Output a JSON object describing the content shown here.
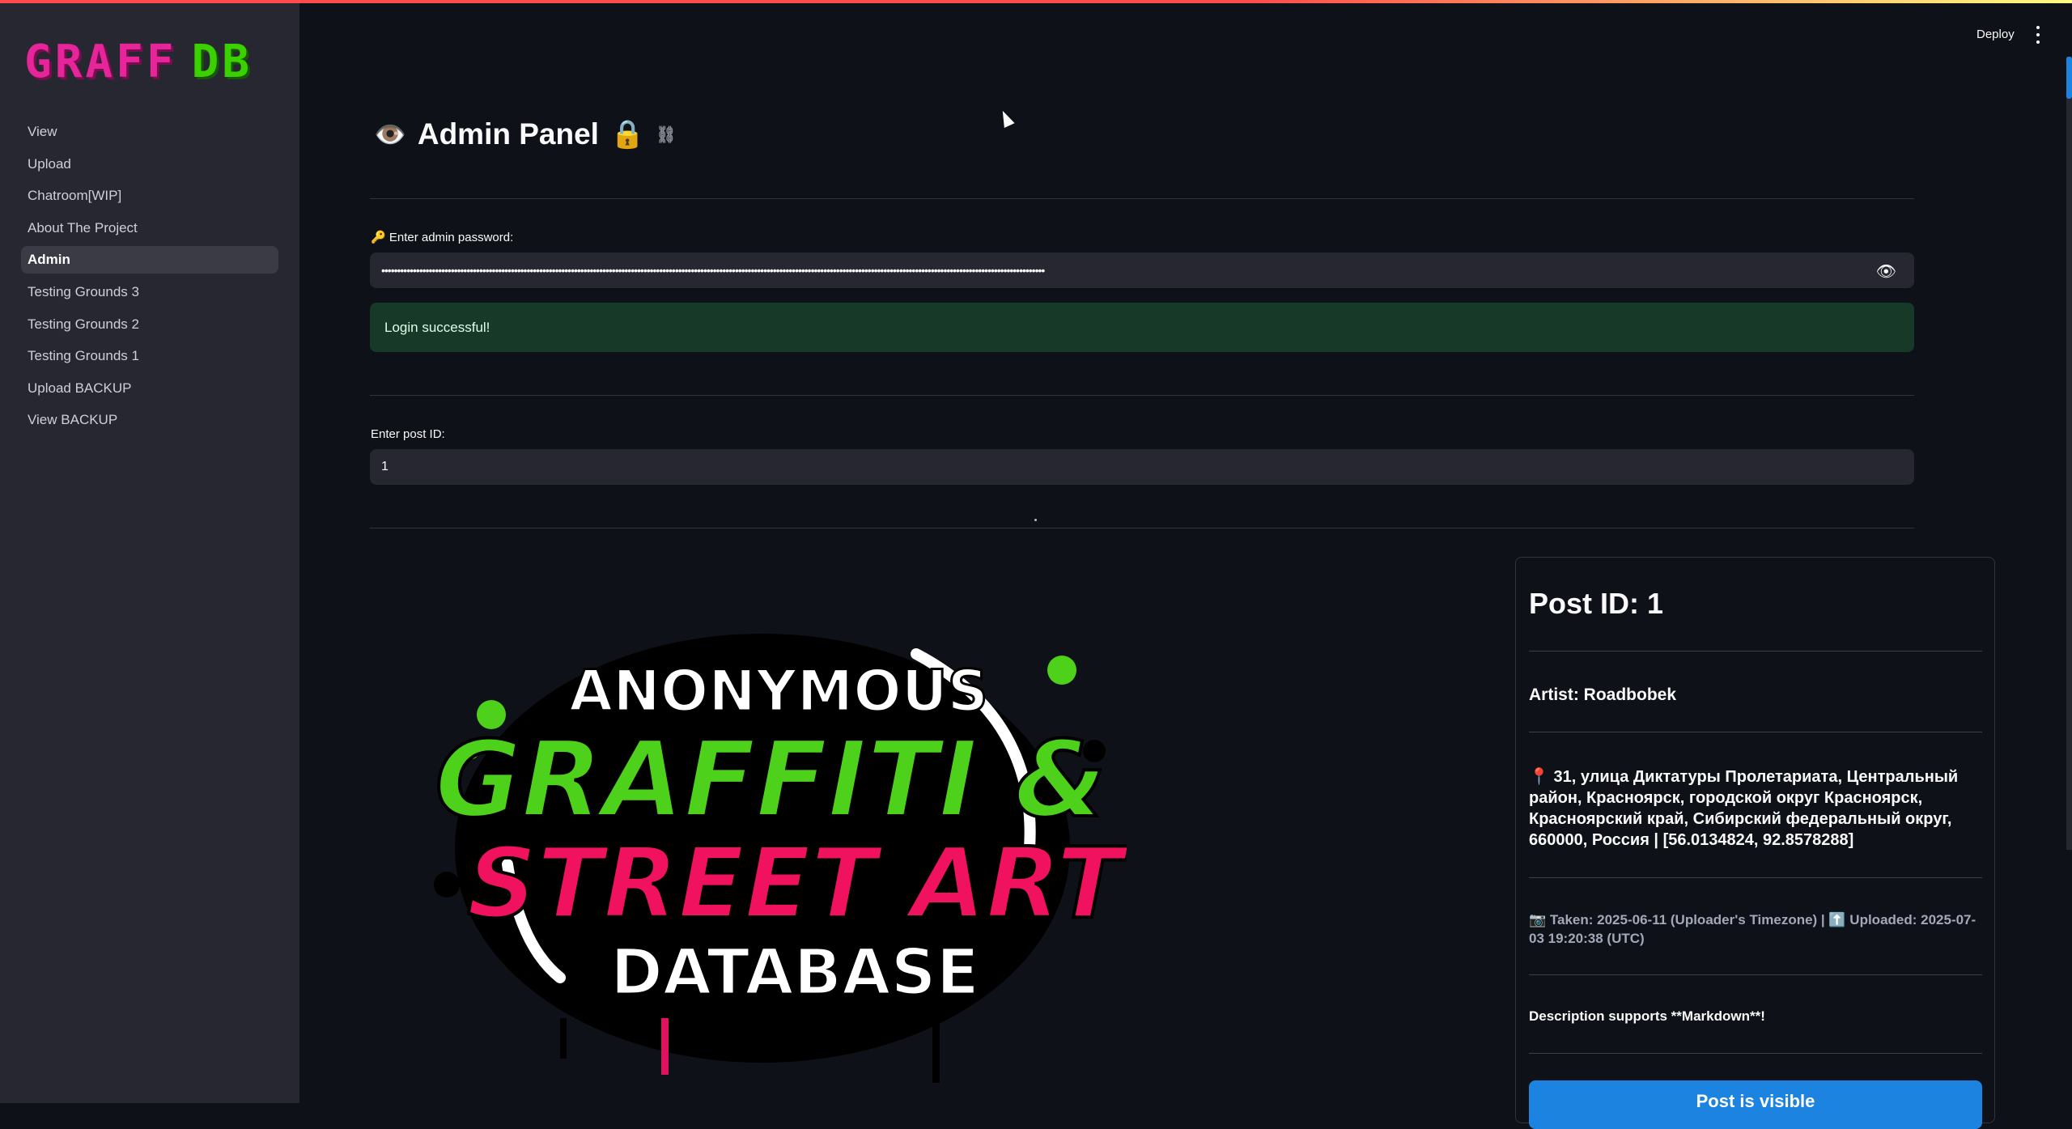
{
  "app": {
    "logo_left": "GRAFF",
    "logo_right": "DB",
    "deploy_label": "Deploy"
  },
  "sidebar": {
    "items": [
      {
        "label": "View"
      },
      {
        "label": "Upload"
      },
      {
        "label": "Chatroom[WIP]"
      },
      {
        "label": "About The Project"
      },
      {
        "label": "Admin",
        "active": true
      },
      {
        "label": "Testing Grounds 3"
      },
      {
        "label": "Testing Grounds 2"
      },
      {
        "label": "Testing Grounds 1"
      },
      {
        "label": "Upload BACKUP"
      },
      {
        "label": "View BACKUP"
      }
    ]
  },
  "main": {
    "title_emoji": "👁️",
    "title": "Admin Panel",
    "title_emoji_after": "🔒",
    "password_label": "🔑 Enter admin password:",
    "password_value": "••••••••••••••••••••••••••••••••••••••••••••••••••••••••••••••••••••••••••••••••••••••••••••••••••••••••••••••••••••••••••••••••••••••••••••••••••••••••••••••••••••••••••••••••••••••••••••••••••••••••••••••••••",
    "login_message": "Login successful!",
    "post_id_label": "Enter post ID:",
    "post_id_value": "1"
  },
  "artwork": {
    "line1": "ANONYMOUS",
    "line2": "GRAFFITI &",
    "line3": "STREET ART",
    "line4": "DATABASE"
  },
  "post": {
    "title": "Post ID: 1",
    "artist": "Artist: Roadbobek",
    "address": "📍 31, улица Диктатуры Пролетариата, Центральный район, Красноярск, городской округ Красноярск, Красноярский край, Сибирский федеральный округ, 660000, Россия | [56.0134824, 92.8578288]",
    "meta": "📷 Taken: 2025-06-11 (Uploader's Timezone) | ⬆️ Uploaded: 2025-07-03 19:20:38 (UTC)",
    "description": "Description supports **Markdown**!",
    "button_label": "Post is visible"
  },
  "colors": {
    "background": "#0e1117",
    "sidebar": "#262730",
    "accent_blue": "#1c83e1",
    "success_bg": "#173928",
    "logo_pink": "#e6259a",
    "logo_green": "#3bd000"
  }
}
